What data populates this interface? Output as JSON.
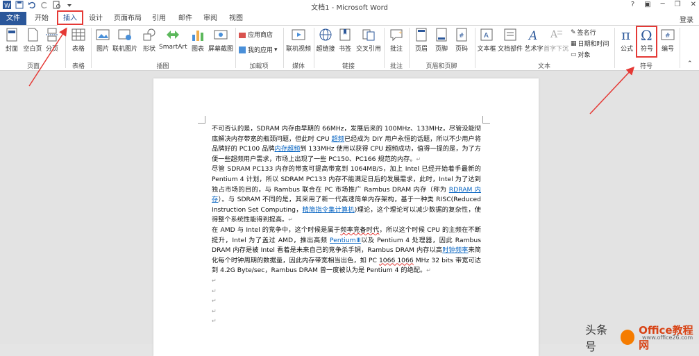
{
  "window": {
    "title": "文档1 - Microsoft Word",
    "help": "?",
    "login": "登录"
  },
  "tabs": [
    "文件",
    "开始",
    "插入",
    "设计",
    "页面布局",
    "引用",
    "邮件",
    "审阅",
    "视图"
  ],
  "ribbon": {
    "pages": [
      "封面",
      "空白页",
      "分页"
    ],
    "table": "表格",
    "illustrations": [
      "图片",
      "联机图片",
      "形状",
      "SmartArt",
      "图表",
      "屏幕截图"
    ],
    "addins": {
      "store": "应用商店",
      "myapps": "我的应用"
    },
    "media": "联机视频",
    "links": [
      "超链接",
      "书签",
      "交叉引用"
    ],
    "comment": "批注",
    "headerfooter": [
      "页眉",
      "页脚",
      "页码"
    ],
    "text": [
      "文本框",
      "文档部件",
      "艺术字",
      "首字下沉"
    ],
    "text_small": [
      "签名行",
      "日期和时间",
      "对象"
    ],
    "symbols": [
      "公式",
      "符号",
      "编号"
    ],
    "groups": [
      "页面",
      "表格",
      "插图",
      "加载项",
      "媒体",
      "链接",
      "批注",
      "页眉和页脚",
      "文本",
      "符号"
    ]
  },
  "document": {
    "paragraphs": [
      [
        {
          "t": "不可否认的是，SDRAM 内存由早期的 66MHz，发展后来的 100MHz、133MHz，尽管没能彻底解决内存带宽的瓶颈问题，但此时 CPU "
        },
        {
          "t": "超频",
          "link": true
        },
        {
          "t": "已经成为 DIY 用户永恒的话题，所以不少用户将品牌好的 PC100 品牌"
        },
        {
          "t": "内存超频",
          "link": true
        },
        {
          "t": "到 133MHz 使用以获得 CPU 超频成功，值得一提的是，为了方便一些超频用户需求，市场上出现了一些 PC150、PC166 规范的内存。"
        }
      ],
      [
        {
          "t": "尽管 SDRAM PC133 内存的带宽可提高带宽到 1064MB/S，加上 Intel 已经开始着手最新的 Pentium 4 计划，所以 SDRAM PC133 内存不能满足日后的发展需求，此时，Intel 为了达到独占市场的目的，与 Rambus 联合在 PC 市场推广 Rambus DRAM 内存（称为 "
        },
        {
          "t": "RDRAM 内存",
          "link": true
        },
        {
          "t": "）。与 SDRAM 不同的是，其采用了新一代高速简单内存架构，基于一种类 RISC(Reduced Instruction Set Computing，"
        },
        {
          "t": "精简指令集计算机",
          "link": true
        },
        {
          "t": ")理论，这个理论可以减少数据的复杂性，使得整个系统性能得到提高。"
        }
      ],
      [
        {
          "t": "在 AMD 与 Intel 的竞争中，这个时候是属于"
        },
        {
          "t": "频率竞备时代",
          "red": true
        },
        {
          "t": "，所以这个时候 CPU 的主频在不断提升，Intel 为了盖过 AMD，推出高频 "
        },
        {
          "t": "PentiumⅢ",
          "link": true
        },
        {
          "t": "以及 Pentium 4 处理器，因此 Rambus DRAM 内存是被 Intel 看着是未来自己的竞争杀手锏，Rambus DRAM 内存以高"
        },
        {
          "t": "时钟频率",
          "link": true
        },
        {
          "t": "来简化每个时钟周期的数据量，因此内存带宽相当出色，如 PC "
        },
        {
          "t": "1066 1066",
          "red": true
        },
        {
          "t": " MHz 32 bits 带宽可达到 4.2G Byte/sec，Rambus DRAM 曾一度被认为是 Pentium 4 的绝配。"
        }
      ]
    ]
  },
  "watermark": {
    "left": "头条号",
    "brand": "Office教程网",
    "url": "www.office26.com"
  },
  "colors": {
    "file_tab": "#2b579a",
    "link": "#0563c1",
    "annotation": "#e53935"
  }
}
